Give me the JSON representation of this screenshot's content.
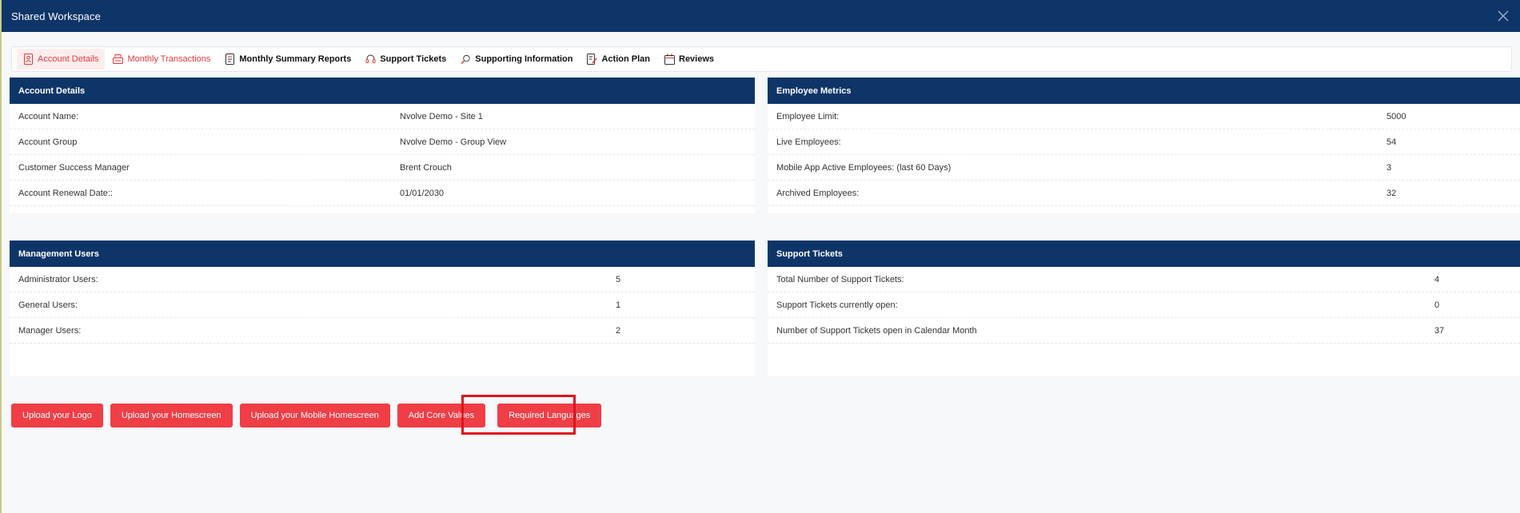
{
  "window": {
    "title": "Shared Workspace"
  },
  "tabs": [
    {
      "label": "Account Details",
      "icon": "document-person-icon",
      "state": "active"
    },
    {
      "label": "Monthly Transactions",
      "icon": "cash-register-icon",
      "state": "red"
    },
    {
      "label": "Monthly Summary Reports",
      "icon": "report-icon",
      "state": "normal"
    },
    {
      "label": "Support Tickets",
      "icon": "headset-icon",
      "state": "normal"
    },
    {
      "label": "Supporting Information",
      "icon": "search-doc-icon",
      "state": "normal"
    },
    {
      "label": "Action Plan",
      "icon": "edit-doc-icon",
      "state": "normal"
    },
    {
      "label": "Reviews",
      "icon": "calendar-icon",
      "state": "normal"
    }
  ],
  "account_details": {
    "title": "Account Details",
    "rows": [
      {
        "label": "Account Name:",
        "value": "Nvolve Demo - Site 1"
      },
      {
        "label": "Account Group",
        "value": "Nvolve Demo - Group View"
      },
      {
        "label": "Customer Success Manager",
        "value": "Brent Crouch"
      },
      {
        "label": "Account Renewal Date::",
        "value": "01/01/2030"
      }
    ]
  },
  "employee_metrics": {
    "title": "Employee Metrics",
    "rows": [
      {
        "label": "Employee Limit:",
        "value": "5000"
      },
      {
        "label": "Live Employees:",
        "value": "54"
      },
      {
        "label": "Mobile App Active Employees: (last 60 Days)",
        "value": "3"
      },
      {
        "label": "Archived Employees:",
        "value": "32"
      }
    ]
  },
  "management_users": {
    "title": "Management Users",
    "rows": [
      {
        "label": "Administrator Users:",
        "value": "5"
      },
      {
        "label": "General Users:",
        "value": "1"
      },
      {
        "label": "Manager Users:",
        "value": "2"
      }
    ]
  },
  "support_tickets": {
    "title": "Support Tickets",
    "rows": [
      {
        "label": "Total Number of Support Tickets:",
        "value": "4"
      },
      {
        "label": "Support Tickets currently open:",
        "value": "0"
      },
      {
        "label": "Number of Support Tickets open in Calendar Month",
        "value": "37"
      }
    ]
  },
  "actions": {
    "upload_logo": "Upload your Logo",
    "upload_homescreen": "Upload your Homescreen",
    "upload_mobile_homescreen": "Upload your Mobile Homescreen",
    "add_core_values": "Add Core Values",
    "required_languages": "Required Languages"
  },
  "colors": {
    "header_navy": "#0e3568",
    "accent_red": "#ef3e46",
    "highlight_red": "#e1121b"
  }
}
